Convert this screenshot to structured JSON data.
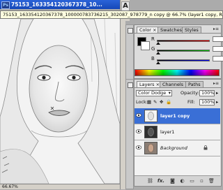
{
  "document": {
    "title": "75153_1633541203673​78_10...",
    "tooltip": "75153_1633541203673​78_100000783736215_302087_978779_n copy @ 66.7% (layer1 copy, RGB/8)",
    "zoom": "66.67%"
  },
  "toolbox": {
    "type_tool_label": "A"
  },
  "color_panel": {
    "tabs": [
      {
        "label": "Color",
        "close": "×"
      },
      {
        "label": "Swatches"
      },
      {
        "label": "Styles"
      }
    ],
    "sliders": [
      {
        "label": "R"
      },
      {
        "label": "G"
      },
      {
        "label": "B"
      }
    ],
    "menu_icon": "▸≡"
  },
  "layers_panel": {
    "tabs": [
      {
        "label": "Layers",
        "close": "×"
      },
      {
        "label": "Channels"
      },
      {
        "label": "Paths"
      }
    ],
    "blend_mode": "Color Dodge",
    "opacity_label": "Opacity:",
    "opacity_value": "100%",
    "lock_label": "Lock:",
    "fill_label": "Fill:",
    "fill_value": "100%",
    "layers": [
      {
        "name": "layer1 copy",
        "selected": true
      },
      {
        "name": "layer1",
        "selected": false
      },
      {
        "name": "Background",
        "selected": false,
        "locked": true
      }
    ],
    "bottom_icons": [
      "link-icon",
      "fx-icon",
      "mask-icon",
      "adjustment-icon",
      "folder-icon",
      "new-layer-icon",
      "trash-icon"
    ],
    "bottom_labels": [
      "⛓",
      "fx.",
      "◙",
      "◐",
      "▭",
      "▫",
      "🗑"
    ]
  },
  "colors": {
    "title_blue": "#1f56c8",
    "selected_layer": "#3a6fd6",
    "panel_bg": "#dcdcdc"
  }
}
